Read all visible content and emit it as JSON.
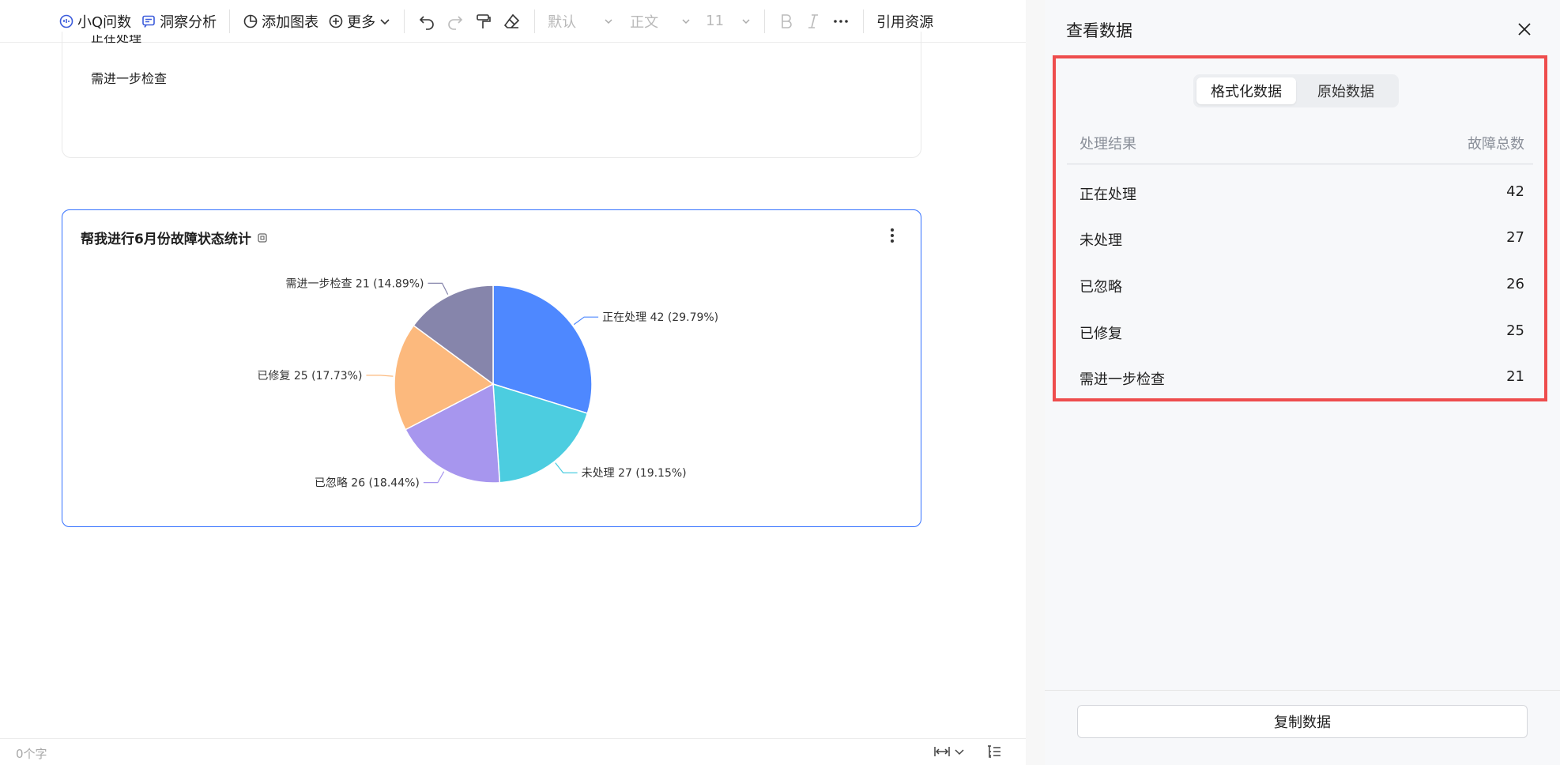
{
  "toolbar": {
    "ask_q": "小Q问数",
    "insight": "洞察分析",
    "add_chart": "添加图表",
    "more": "更多",
    "style_select": "默认",
    "para_select": "正文",
    "size_select": "11",
    "cite": "引用资源"
  },
  "doc": {
    "partial_line": "正在处理",
    "line2": "需进一步检查"
  },
  "chart_card": {
    "title": "帮我进行6月份故障状态统计"
  },
  "chart_data": {
    "type": "pie",
    "title": "帮我进行6月份故障状态统计",
    "slices": [
      {
        "label": "正在处理",
        "value": 42,
        "percent": "29.79%",
        "color": "#4e88ff"
      },
      {
        "label": "未处理",
        "value": 27,
        "percent": "19.15%",
        "color": "#4ccde0"
      },
      {
        "label": "已忽略",
        "value": 26,
        "percent": "18.44%",
        "color": "#a796ee"
      },
      {
        "label": "已修复",
        "value": 25,
        "percent": "17.73%",
        "color": "#fcb97d"
      },
      {
        "label": "需进一步检查",
        "value": 21,
        "percent": "14.89%",
        "color": "#8685ab"
      }
    ]
  },
  "status": {
    "word_count": "0个字"
  },
  "panel": {
    "title": "查看数据",
    "tabs": [
      "格式化数据",
      "原始数据"
    ],
    "columns": [
      "处理结果",
      "故障总数"
    ],
    "rows": [
      {
        "name": "正在处理",
        "count": "42"
      },
      {
        "name": "未处理",
        "count": "27"
      },
      {
        "name": "已忽略",
        "count": "26"
      },
      {
        "name": "已修复",
        "count": "25"
      },
      {
        "name": "需进一步检查",
        "count": "21"
      }
    ],
    "copy_label": "复制数据"
  },
  "colors": {
    "accent": "#3370ff",
    "highlight_border": "#ee4d4d"
  }
}
